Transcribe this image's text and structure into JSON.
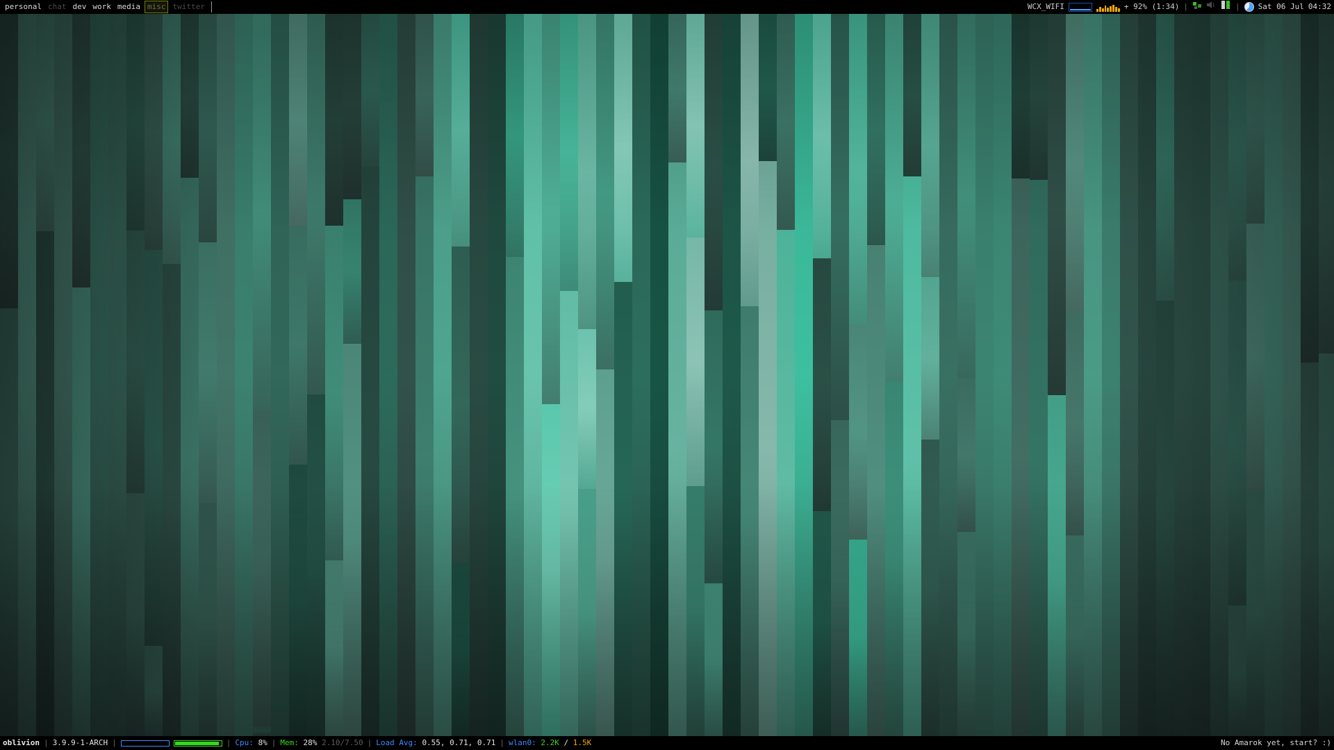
{
  "top_bar": {
    "tags": [
      {
        "label": "personal",
        "state": "occupied"
      },
      {
        "label": "chat",
        "state": "empty"
      },
      {
        "label": "dev",
        "state": "occupied"
      },
      {
        "label": "work",
        "state": "occupied"
      },
      {
        "label": "media",
        "state": "occupied"
      },
      {
        "label": "misc",
        "state": "current"
      },
      {
        "label": "twitter",
        "state": "empty"
      }
    ],
    "wifi_name": "WCX_WIFI",
    "battery_text": "+ 92% (1:34)",
    "datetime": "Sat 06 Jul",
    "time": "04:32"
  },
  "bottom_bar": {
    "hostname": "oblivion",
    "kernel": "3.9.9-1-ARCH",
    "cpu_label": "Cpu:",
    "cpu_value": "8%",
    "mem_label": "Mem:",
    "mem_value": "28%",
    "mem_detail": "2.10/7.50",
    "load_label": "Load Avg:",
    "load_value": "0.55, 0.71, 0.71",
    "net_label": "wlan0:",
    "net_down": "2.2K",
    "net_slash": "/",
    "net_up": "1.5K",
    "music_status": "No Amarok yet, start? :)"
  },
  "meters": {
    "meter_a": 0.0,
    "meter_b": 0.96
  },
  "colors": {
    "bar_bg": "#000000",
    "current_tag_border": "#6f7d18",
    "accent_blue": "#3a8cff",
    "accent_green": "#39d61f",
    "accent_orange": "#f5a800",
    "wallpaper_teal": "#5fc4ad"
  },
  "icons": [
    "network-graph-icon",
    "cpu-graph-icon",
    "network-status-icon",
    "volume-icon",
    "battery-icon",
    "pie-clock-icon"
  ]
}
